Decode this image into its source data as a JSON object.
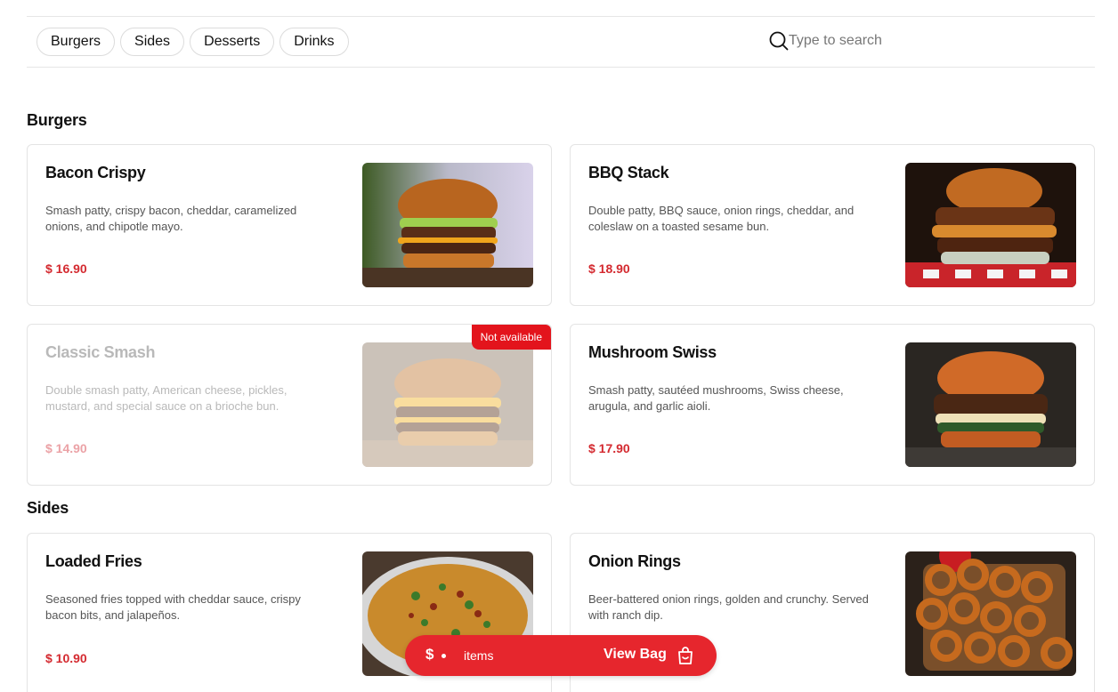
{
  "categories": [
    "Burgers",
    "Sides",
    "Desserts",
    "Drinks"
  ],
  "search": {
    "placeholder": "Type to search"
  },
  "sections": [
    {
      "title": "Burgers",
      "items": [
        {
          "name": "Bacon Crispy",
          "description": "Smash patty, crispy bacon, cheddar, caramelized onions, and chipotle mayo.",
          "price": "$ 16.90",
          "available": true
        },
        {
          "name": "BBQ Stack",
          "description": "Double patty, BBQ sauce, onion rings, cheddar, and coleslaw on a toasted sesame bun.",
          "price": "$ 18.90",
          "available": true
        },
        {
          "name": "Classic Smash",
          "description": "Double smash patty, American cheese, pickles, mustard, and special sauce on a brioche bun.",
          "price": "$ 14.90",
          "available": false,
          "badge": "Not available"
        },
        {
          "name": "Mushroom Swiss",
          "description": "Smash patty, sautéed mushrooms, Swiss cheese, arugula, and garlic aioli.",
          "price": "$ 17.90",
          "available": true
        }
      ]
    },
    {
      "title": "Sides",
      "items": [
        {
          "name": "Loaded Fries",
          "description": "Seasoned fries topped with cheddar sauce, crispy bacon bits, and jalapeños.",
          "price": "$ 10.90",
          "available": true
        },
        {
          "name": "Onion Rings",
          "description": "Beer-battered onion rings, golden and crunchy. Served with ranch dip.",
          "price": "",
          "available": true
        }
      ]
    }
  ],
  "bag": {
    "currency": "$",
    "items_label": "items",
    "view_label": "View Bag"
  },
  "colors": {
    "accent": "#e6262d",
    "price": "#d42a30",
    "badge": "#e3141c"
  },
  "icons": {
    "search": "search-icon",
    "bag": "shopping-bag-icon"
  }
}
